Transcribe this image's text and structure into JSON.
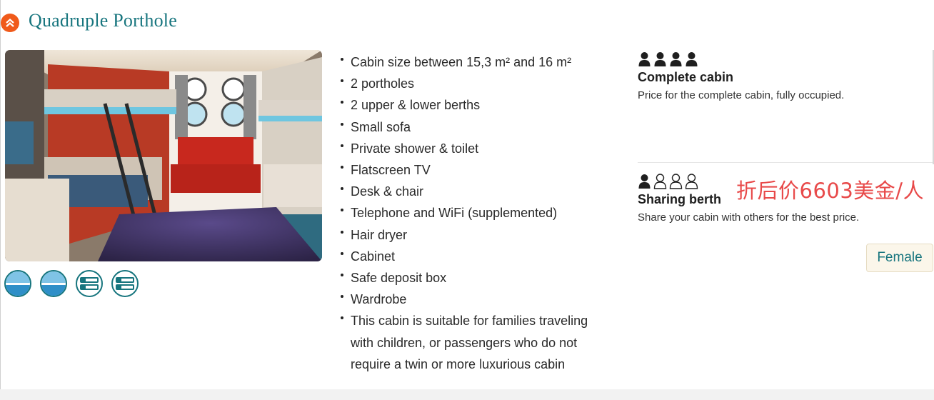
{
  "cabin": {
    "title": "Quadruple Porthole",
    "collapse_icon": "chevron-double-up-icon",
    "accent_color": "#17757e",
    "collapse_color": "#f05a1a",
    "photo_alt": "Quadruple porthole cabin photo",
    "thumbnails": [
      {
        "icon": "porthole-view-icon"
      },
      {
        "icon": "porthole-view-icon"
      },
      {
        "icon": "bunk-bed-icon"
      },
      {
        "icon": "bunk-bed-icon"
      }
    ]
  },
  "features": [
    "Cabin size between 15,3 m² and 16 m²",
    "2 portholes",
    "2 upper & lower berths",
    "Small sofa",
    "Private shower & toilet",
    "Flatscreen TV",
    "Desk & chair",
    "Telephone and WiFi (supplemented)",
    "Hair dryer",
    "Cabinet",
    "Safe deposit box",
    "Wardrobe",
    "This cabin is suitable for families traveling with children, or passengers who do not require a twin or more luxurious cabin"
  ],
  "pricing": {
    "complete": {
      "title": "Complete cabin",
      "description": "Price for the complete cabin, fully occupied.",
      "occupancy_filled": 4,
      "occupancy_total": 4
    },
    "sharing": {
      "title": "Sharing berth",
      "description": "Share your cabin with others for the best price.",
      "occupancy_filled": 1,
      "occupancy_total": 4,
      "gender_button": "Female"
    },
    "promo_text": "折后价6603美金/人",
    "promo_color": "#e84a4a"
  }
}
